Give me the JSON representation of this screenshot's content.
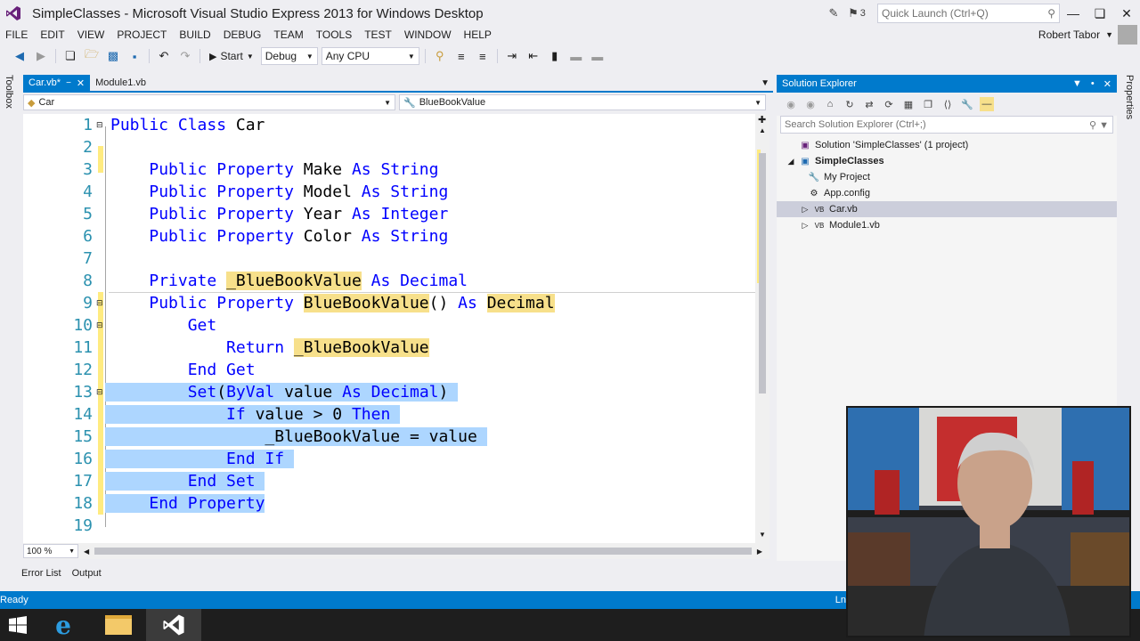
{
  "window": {
    "title": "SimpleClasses - Microsoft Visual Studio Express 2013 for Windows Desktop",
    "notification_count": "3",
    "quick_launch_placeholder": "Quick Launch (Ctrl+Q)"
  },
  "menu": {
    "items": [
      "FILE",
      "EDIT",
      "VIEW",
      "PROJECT",
      "BUILD",
      "DEBUG",
      "TEAM",
      "TOOLS",
      "TEST",
      "WINDOW",
      "HELP"
    ],
    "user": "Robert Tabor"
  },
  "toolbar": {
    "start_label": "Start",
    "config": "Debug",
    "platform": "Any CPU"
  },
  "toolbox": {
    "label": "Toolbox"
  },
  "tabs": [
    {
      "label": "Car.vb*",
      "active": true
    },
    {
      "label": "Module1.vb",
      "active": false
    }
  ],
  "navbar": {
    "class_combo": "Car",
    "member_combo": "BlueBookValue"
  },
  "code": {
    "lines": [
      {
        "n": "1",
        "text": "Public Class Car"
      },
      {
        "n": "2",
        "text": ""
      },
      {
        "n": "3",
        "text": "    Public Property Make As String"
      },
      {
        "n": "4",
        "text": "    Public Property Model As String"
      },
      {
        "n": "5",
        "text": "    Public Property Year As Integer"
      },
      {
        "n": "6",
        "text": "    Public Property Color As String"
      },
      {
        "n": "7",
        "text": ""
      },
      {
        "n": "8",
        "text": "    Private _BlueBookValue As Decimal"
      },
      {
        "n": "9",
        "text": "    Public Property BlueBookValue() As Decimal"
      },
      {
        "n": "10",
        "text": "        Get"
      },
      {
        "n": "11",
        "text": "            Return _BlueBookValue"
      },
      {
        "n": "12",
        "text": "        End Get"
      },
      {
        "n": "13",
        "text": "        Set(ByVal value As Decimal)"
      },
      {
        "n": "14",
        "text": "            If value > 0 Then"
      },
      {
        "n": "15",
        "text": "                _BlueBookValue = value"
      },
      {
        "n": "16",
        "text": "            End If"
      },
      {
        "n": "17",
        "text": "        End Set"
      },
      {
        "n": "18",
        "text": "    End Property"
      },
      {
        "n": "19",
        "text": ""
      }
    ],
    "zoom": "100 %"
  },
  "bottom_tabs": [
    "Error List",
    "Output"
  ],
  "solution_explorer": {
    "title": "Solution Explorer",
    "search_placeholder": "Search Solution Explorer (Ctrl+;)",
    "tree": [
      {
        "label": "Solution 'SimpleClasses' (1 project)",
        "icon": "solution-icon",
        "level": 0
      },
      {
        "label": "SimpleClasses",
        "icon": "vb-project-icon",
        "level": 1,
        "bold": true
      },
      {
        "label": "My Project",
        "icon": "wrench-icon",
        "level": 2
      },
      {
        "label": "App.config",
        "icon": "config-icon",
        "level": 2
      },
      {
        "label": "Car.vb",
        "icon": "vb-file-icon",
        "level": 2,
        "selected": true
      },
      {
        "label": "Module1.vb",
        "icon": "vb-file-icon",
        "level": 2
      }
    ],
    "side_label": "Properties"
  },
  "status": {
    "left": "Ready",
    "right": "Ln"
  },
  "colors": {
    "accent": "#007ACC",
    "keyword": "#0000FF",
    "line_number": "#2B91AF",
    "highlight": "#F7E08B",
    "selection": "#ADD6FF"
  }
}
